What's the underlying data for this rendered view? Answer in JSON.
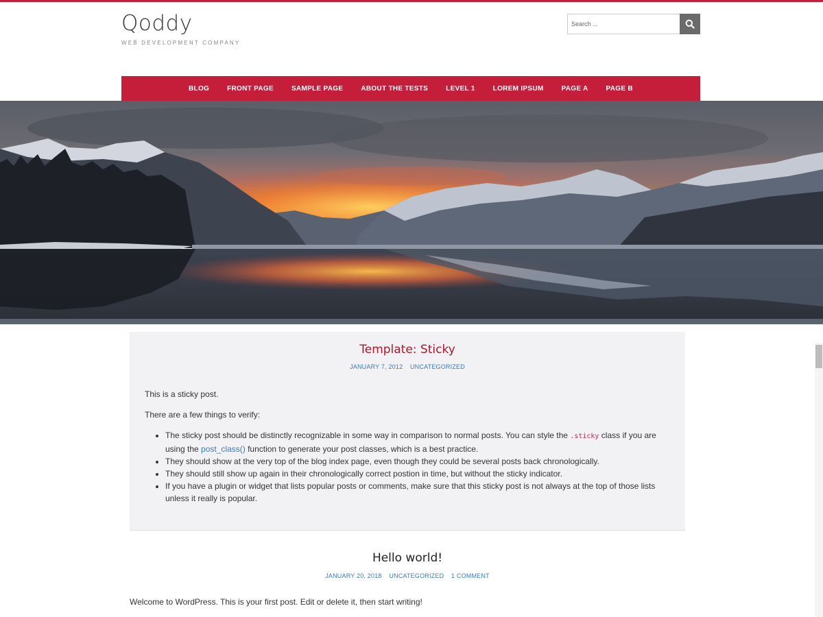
{
  "site": {
    "title": "Qoddy",
    "description": "WEB DEVELOPMENT COMPANY",
    "accent_color": "#c41e3a"
  },
  "search": {
    "placeholder": "Search ...",
    "icon": "search-icon"
  },
  "nav": {
    "items": [
      {
        "label": "BLOG"
      },
      {
        "label": "FRONT PAGE"
      },
      {
        "label": "SAMPLE PAGE"
      },
      {
        "label": "ABOUT THE TESTS"
      },
      {
        "label": "LEVEL 1"
      },
      {
        "label": "LOREM IPSUM"
      },
      {
        "label": "PAGE A"
      },
      {
        "label": "PAGE B"
      }
    ]
  },
  "posts": [
    {
      "title": "Template: Sticky",
      "date": "JANUARY 7, 2012",
      "category": "UNCATEGORIZED",
      "p1": "This is a sticky post.",
      "p2": "There are a few things to verify:",
      "li1_a": "The sticky post should be distinctly recognizable in some way in comparison to normal posts. You can style the ",
      "li1_code": ".sticky",
      "li1_b": " class if you are using the ",
      "li1_link": "post_class()",
      "li1_c": " function to generate your post classes, which is a best practice.",
      "li2": "They should show at the very top of the blog index page, even though they could be several posts back chronologically.",
      "li3": "They should still show up again in their chronologically correct postion in time, but without the sticky indicator.",
      "li4": "If you have a plugin or widget that lists popular posts or comments, make sure that this sticky post is not always at the top of those lists unless it really is popular."
    },
    {
      "title": "Hello world!",
      "date": "JANUARY 20, 2018",
      "category": "UNCATEGORIZED",
      "comments": "1 COMMENT",
      "excerpt": "Welcome to WordPress. This is your first post. Edit or delete it, then start writing!"
    }
  ]
}
